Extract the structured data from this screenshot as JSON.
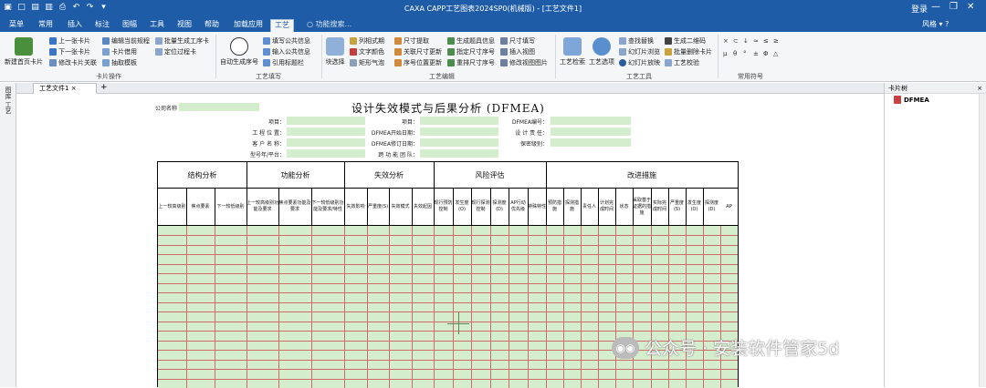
{
  "titlebar": {
    "title": "CAXA CAPP工艺图表2024SP0(机械版) - [工艺文件1]",
    "login": "登录",
    "qa_icons": [
      "app-icon",
      "new-icon",
      "save-icon",
      "save-as-icon",
      "print-icon",
      "undo-icon",
      "redo-icon",
      "more-icon"
    ],
    "window_controls": [
      "—",
      "❐",
      "✕"
    ]
  },
  "menubar": {
    "tabs": [
      "菜单",
      "常用",
      "插入",
      "标注",
      "图幅",
      "工具",
      "视图",
      "帮助",
      "加载应用",
      "工艺"
    ],
    "active_tab": "工艺",
    "search_placeholder": "功能搜索...",
    "style_label": "风格"
  },
  "ribbon": {
    "new_label": "新建首页卡片",
    "card_ops": [
      "上一张卡片",
      "下一张卡片",
      "修改卡片关联",
      "编辑当前规程",
      "卡片借用",
      "抽取模板",
      "批量生成工序卡",
      "定位过程卡"
    ],
    "group_card": "卡片操作",
    "auto_seq_label": "自动生成序号",
    "fill_ops": [
      "填写公共信息",
      "输入公共信息",
      "引用标题栏"
    ],
    "group_fill": "工艺填写",
    "block_select": "块选择",
    "edit_ops": [
      "列相式期",
      "文字颜色",
      "矩形气泡",
      "尺寸提取",
      "关联尺寸更新",
      "序号位置更新",
      "生成题具信息",
      "指定尺寸序号",
      "重排尺寸序号",
      "尺寸填写",
      "插入视图",
      "修改视图图片"
    ],
    "group_edit": "工艺编辑",
    "tool_big": [
      "工艺检索",
      "工艺选项"
    ],
    "tool_ops": [
      "查找替换",
      "幻灯片浏览",
      "幻灯片放映",
      "生成二维码",
      "批量删除卡片",
      "工艺校验"
    ],
    "group_tool": "工艺工具",
    "symbols": [
      "×",
      "⊂",
      "↓",
      "≈",
      "≤",
      "≥",
      "μ",
      "θ",
      "°",
      "±",
      "Φ",
      "△"
    ],
    "group_symbol": "常用符号"
  },
  "doctab": {
    "label": "工艺文件1",
    "close": "×",
    "plus": "+"
  },
  "leftstrip": {
    "label": "图库 工艺"
  },
  "rightpanel": {
    "title": "卡片树",
    "close": "×",
    "root": "DFMEA"
  },
  "document": {
    "title": "设计失效模式与后果分析 (DFMEA)",
    "header_fields": [
      "公司名称",
      "项目：",
      "工  程  位  置：",
      "客  户  名  称：",
      "型号年/平台：",
      "项目：",
      "DFMEA开始日期：",
      "DFMEA修订日期：",
      "跨 功 能 团 队：",
      "DFMEA编号：",
      "设 计 责 任：",
      "保密级别："
    ],
    "sections": [
      "结构分析",
      "功能分析",
      "失效分析",
      "风险评估",
      "改进措施"
    ],
    "sub_headers": [
      "上一较高级别",
      "焦点要素",
      "下一较低级别",
      "上一较高级别功能及要求",
      "焦点要素功能及要求",
      "下一较低级别功能及要求/特性",
      "失效影响",
      "严重度(S)",
      "失效模式",
      "失效起因",
      "现行预防控制",
      "发生度(O)",
      "现行探测控制",
      "探测度(D)",
      "AP行动优先级",
      "特殊特性",
      "预防措施",
      "探测措施",
      "责任人",
      "计划完成时间",
      "状态",
      "采取基于证据的措施",
      "实际完成时间",
      "严重度(S)",
      "发生度(O)",
      "探测度(D)",
      "AP"
    ]
  },
  "watermark": {
    "text": "公众号 · 安装软件管家5d"
  },
  "colors": {
    "brand": "#1e5ca8",
    "field": "#d4edcc",
    "gridline": "#cf6b6b"
  }
}
